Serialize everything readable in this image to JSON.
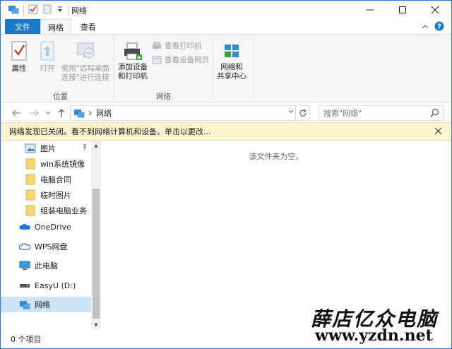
{
  "window": {
    "title": "网络"
  },
  "tabs": {
    "file": "文件",
    "network": "网络",
    "view": "查看"
  },
  "ribbon": {
    "properties": "属性",
    "open": "打开",
    "remote_desktop_line1": "使用\"远程桌面",
    "remote_desktop_line2": "连接\"进行连接",
    "location_group": "位置",
    "add_devices_line1": "添加设备",
    "add_devices_line2": "和打印机",
    "view_printers": "查看打印机",
    "view_device_page": "查看设备网页",
    "network_group": "网络",
    "network_center_line1": "网络和",
    "network_center_line2": "共享中心"
  },
  "address": {
    "crumb": "网络",
    "search_placeholder": "搜索\"网络\""
  },
  "infobar": {
    "message": "网络发现已关闭。看不到网络计算机和设备。单击以更改..."
  },
  "navpane": {
    "items": [
      {
        "label": "图片"
      },
      {
        "label": "win系统镜像"
      },
      {
        "label": "电脑合同"
      },
      {
        "label": "临时图片"
      },
      {
        "label": "组装电脑业务"
      },
      {
        "label": "OneDrive"
      },
      {
        "label": "WPS网盘"
      },
      {
        "label": "此电脑"
      },
      {
        "label": "EasyU (D:)"
      },
      {
        "label": "网络"
      }
    ]
  },
  "content": {
    "empty_message": "该文件夹为空。"
  },
  "status": {
    "item_count": "0 个项目"
  },
  "watermark": {
    "line1": "薛店亿众电脑",
    "line2": "www.yzdn.net"
  },
  "colors": {
    "accent": "#1979ca",
    "selected": "#cce4f7",
    "infobar": "#fcf3cf",
    "folder": "#f8d775"
  }
}
